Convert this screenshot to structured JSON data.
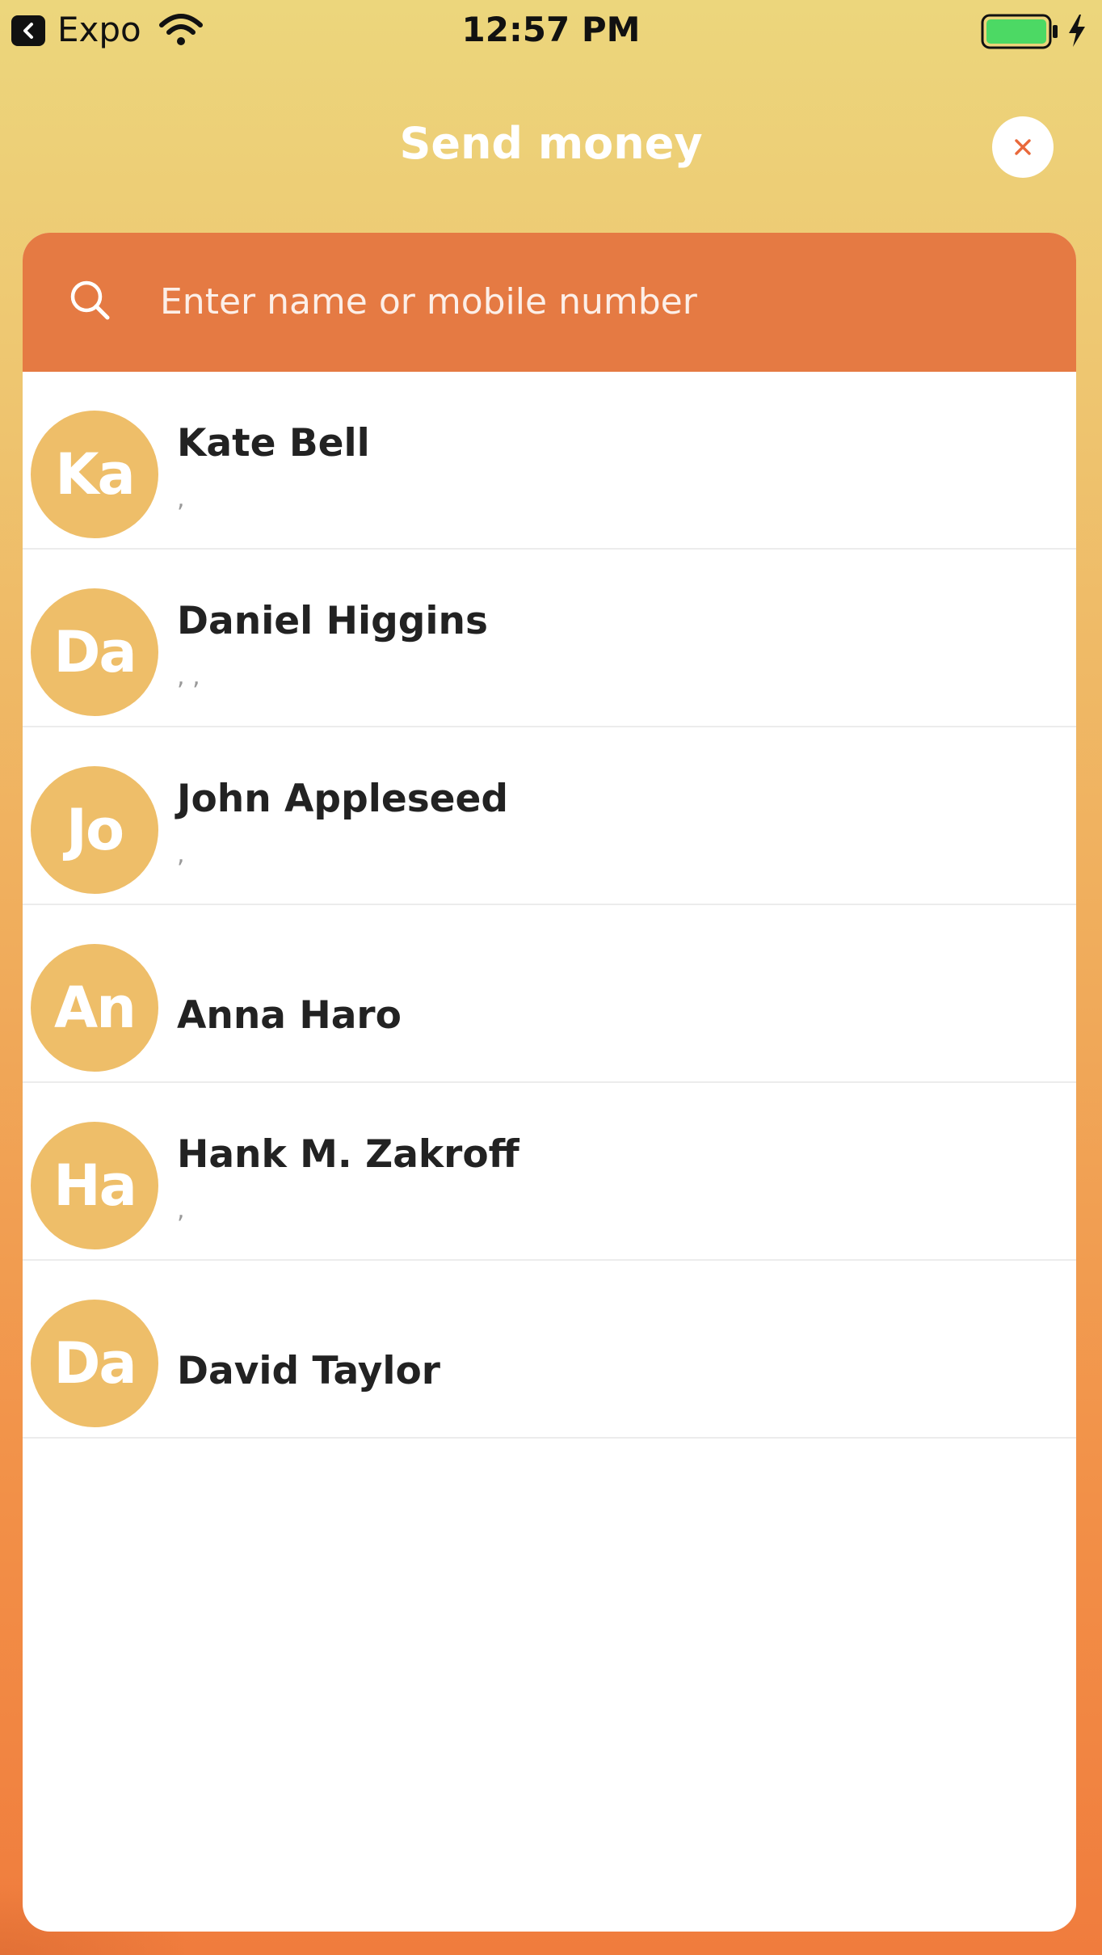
{
  "status_bar": {
    "back_app": "Expo",
    "time": "12:57 PM",
    "icons": [
      "back-to-app-icon",
      "wifi-icon",
      "battery-icon",
      "charging-bolt-icon"
    ],
    "battery_level": 1.0,
    "battery_color": "#4cd964"
  },
  "header": {
    "title": "Send money",
    "close_icon": "close-icon"
  },
  "search": {
    "icon": "search-icon",
    "placeholder": "Enter name or mobile number",
    "value": ""
  },
  "contacts": [
    {
      "initials": "Ka",
      "name": "Kate Bell",
      "detail": ","
    },
    {
      "initials": "Da",
      "name": "Daniel Higgins",
      "detail": ", ,"
    },
    {
      "initials": "Jo",
      "name": "John Appleseed",
      "detail": ","
    },
    {
      "initials": "An",
      "name": "Anna Haro",
      "detail": ""
    },
    {
      "initials": "Ha",
      "name": "Hank M. Zakroff",
      "detail": ","
    },
    {
      "initials": "Da",
      "name": "David Taylor",
      "detail": ""
    }
  ],
  "colors": {
    "background_top": "#ecd67c",
    "background_bottom": "#f07c3d",
    "search_bar": "#e57a43",
    "avatar": "#eebe69",
    "close_x": "#e9693b"
  }
}
